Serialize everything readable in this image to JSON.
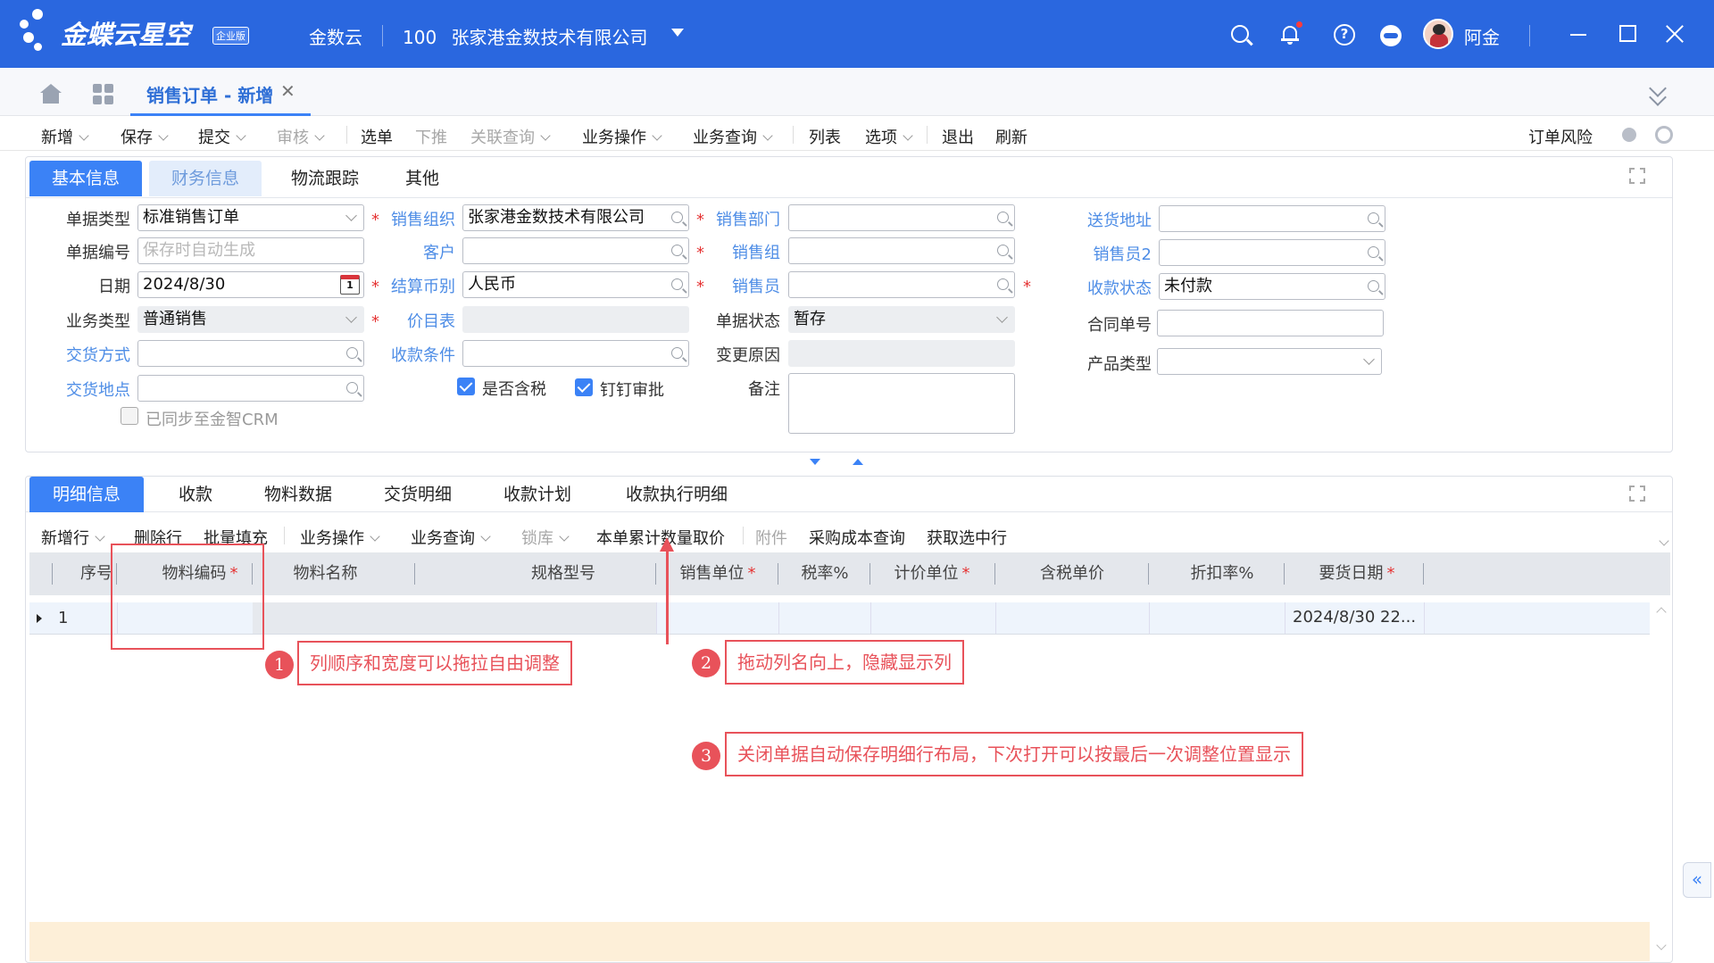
{
  "topbar": {
    "logo_text": "金蝶云星空",
    "edition_badge": "企业版",
    "nav_item": "金数云",
    "org_code": "100",
    "org_name": "张家港金数技术有限公司",
    "user_name": "阿金",
    "icons": [
      "search-icon",
      "bell-icon",
      "help-icon",
      "settings-pill-icon",
      "avatar",
      "minimize-icon",
      "maximize-icon",
      "close-icon"
    ],
    "bg_color": "#2a67df"
  },
  "tabs": {
    "home_icon": "home-icon",
    "grid_icon": "apps-icon",
    "active_tab": "销售订单 - 新增",
    "close_symbol": "✕"
  },
  "toolbar": {
    "items": [
      {
        "label": "新增",
        "caret": true,
        "disabled": false
      },
      {
        "label": "保存",
        "caret": true,
        "disabled": false
      },
      {
        "label": "提交",
        "caret": true,
        "disabled": false
      },
      {
        "label": "审核",
        "caret": true,
        "disabled": true
      },
      {
        "label": "选单",
        "caret": false,
        "disabled": false
      },
      {
        "label": "下推",
        "caret": false,
        "disabled": true
      },
      {
        "label": "关联查询",
        "caret": true,
        "disabled": true
      },
      {
        "label": "业务操作",
        "caret": true,
        "disabled": false
      },
      {
        "label": "业务查询",
        "caret": true,
        "disabled": false
      },
      {
        "label": "列表",
        "caret": false,
        "disabled": false
      },
      {
        "label": "选项",
        "caret": true,
        "disabled": false
      },
      {
        "label": "退出",
        "caret": false,
        "disabled": false
      },
      {
        "label": "刷新",
        "caret": false,
        "disabled": false
      }
    ],
    "right_label": "订单风险"
  },
  "header_panel": {
    "tabs": [
      "基本信息",
      "财务信息",
      "物流跟踪",
      "其他"
    ],
    "fields": {
      "doc_type": {
        "label": "单据类型",
        "value": "标准销售订单"
      },
      "doc_no": {
        "label": "单据编号",
        "placeholder": "保存时自动生成"
      },
      "date": {
        "label": "日期",
        "value": "2024/8/30",
        "calendar_day": "1"
      },
      "biz_type": {
        "label": "业务类型",
        "value": "普通销售"
      },
      "delivery_method": {
        "label": "交货方式",
        "value": ""
      },
      "delivery_place": {
        "label": "交货地点",
        "value": ""
      },
      "sync_crm": {
        "label": "已同步至金智CRM",
        "checked": false
      },
      "sales_org": {
        "label": "销售组织",
        "value": "张家港金数技术有限公司"
      },
      "customer": {
        "label": "客户",
        "value": ""
      },
      "currency": {
        "label": "结算币别",
        "value": "人民币"
      },
      "price_list": {
        "label": "价目表",
        "value": ""
      },
      "payment_terms": {
        "label": "收款条件",
        "value": ""
      },
      "tax_included": {
        "label": "是否含税",
        "checked": true
      },
      "dingtalk": {
        "label": "钉钉审批",
        "checked": true
      },
      "sales_dept": {
        "label": "销售部门",
        "value": ""
      },
      "sales_group": {
        "label": "销售组",
        "value": ""
      },
      "salesperson": {
        "label": "销售员",
        "value": ""
      },
      "doc_status": {
        "label": "单据状态",
        "value": "暂存"
      },
      "change_reason": {
        "label": "变更原因",
        "value": ""
      },
      "remark": {
        "label": "备注",
        "value": ""
      },
      "ship_address": {
        "label": "送货地址",
        "value": ""
      },
      "salesperson2": {
        "label": "销售员2",
        "value": ""
      },
      "collection_status": {
        "label": "收款状态",
        "value": "未付款"
      },
      "contract_no": {
        "label": "合同单号",
        "value": ""
      },
      "product_type": {
        "label": "产品类型",
        "value": ""
      }
    }
  },
  "detail_panel": {
    "tabs": [
      "明细信息",
      "收款",
      "物料数据",
      "交货明细",
      "收款计划",
      "收款执行明细"
    ],
    "toolbar": [
      {
        "label": "新增行",
        "caret": true,
        "disabled": false
      },
      {
        "label": "删除行",
        "caret": false,
        "disabled": false
      },
      {
        "label": "批量填充",
        "caret": false,
        "disabled": false
      },
      {
        "label": "业务操作",
        "caret": true,
        "disabled": false
      },
      {
        "label": "业务查询",
        "caret": true,
        "disabled": false
      },
      {
        "label": "锁库",
        "caret": true,
        "disabled": true
      },
      {
        "label": "本单累计数量取价",
        "caret": false,
        "disabled": false
      },
      {
        "label": "附件",
        "caret": false,
        "disabled": true
      },
      {
        "label": "采购成本查询",
        "caret": false,
        "disabled": false
      },
      {
        "label": "获取选中行",
        "caret": false,
        "disabled": false
      }
    ],
    "columns": [
      {
        "label": "序号",
        "required": false
      },
      {
        "label": "物料编码",
        "required": true
      },
      {
        "label": "物料名称",
        "required": false
      },
      {
        "label": "规格型号",
        "required": false
      },
      {
        "label": "销售单位",
        "required": true
      },
      {
        "label": "税率%",
        "required": false
      },
      {
        "label": "计价单位",
        "required": true
      },
      {
        "label": "含税单价",
        "required": false
      },
      {
        "label": "折扣率%",
        "required": false
      },
      {
        "label": "要货日期",
        "required": true
      }
    ],
    "rows": [
      {
        "seq": "1",
        "delivery_date": "2024/8/30 22..."
      }
    ]
  },
  "annotations": [
    {
      "num": "1",
      "text": "列顺序和宽度可以拖拉自由调整"
    },
    {
      "num": "2",
      "text": "拖动列名向上，隐藏显示列"
    },
    {
      "num": "3",
      "text": "关闭单据自动保存明细行布局，下次打开可以按最后一次调整位置显示"
    }
  ],
  "colors": {
    "accent": "#3b82f6",
    "annotation": "#e8525a",
    "required": "#e53333"
  }
}
